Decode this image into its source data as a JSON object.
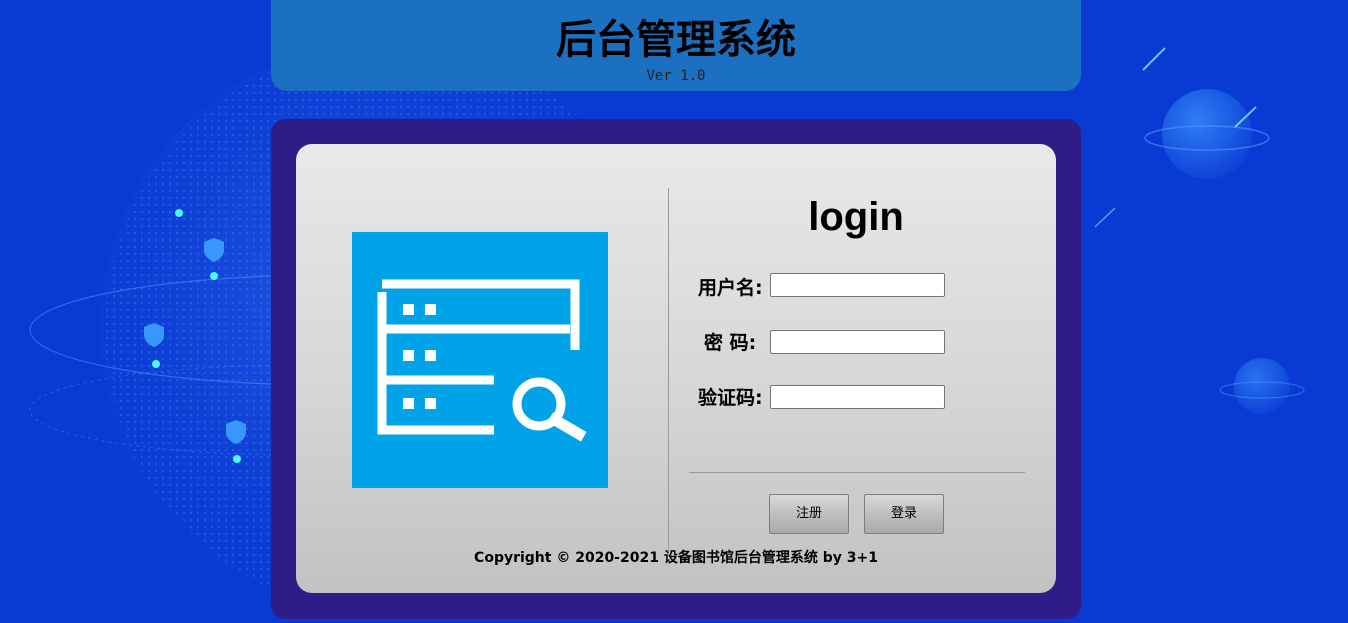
{
  "header": {
    "title": "后台管理系统",
    "version": "Ver 1.0"
  },
  "login": {
    "title": "login",
    "fields": [
      {
        "label": "用户名:",
        "value": "",
        "icon": "user"
      },
      {
        "label": "密 码:",
        "value": "",
        "icon": "password"
      },
      {
        "label": "验证码:",
        "value": "",
        "icon": "captcha"
      }
    ],
    "buttons": {
      "register": "注册",
      "login": "登录"
    }
  },
  "logo": {
    "icon": "server-search-icon",
    "background": "#00a3e8"
  },
  "footer": {
    "copyright": "Copyright © 2020-2021 设备图书馆后台管理系统 by 3+1"
  },
  "colors": {
    "background": "#0a3ad4",
    "header": "#1b70c1",
    "panel": "#301c88",
    "logo": "#00a3e8"
  }
}
